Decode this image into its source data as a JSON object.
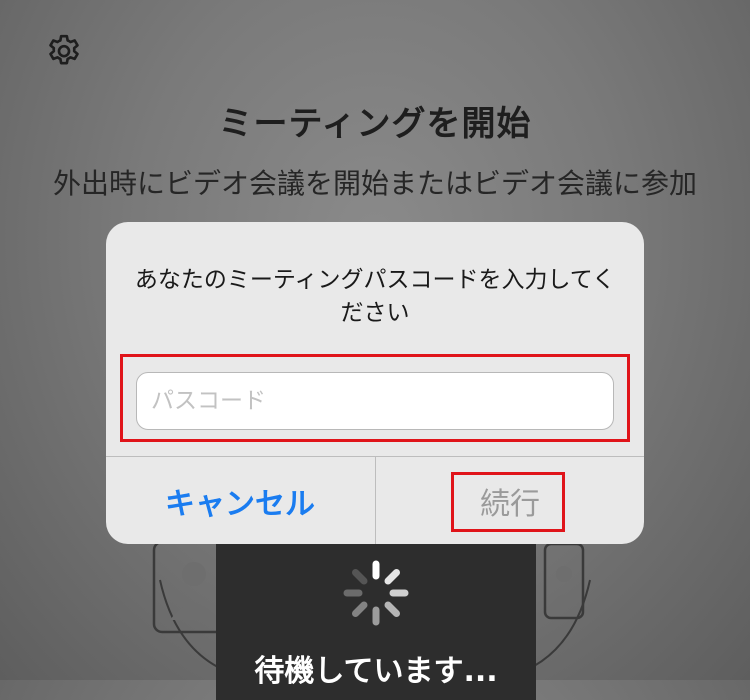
{
  "screen": {
    "title": "ミーティングを開始",
    "subtitle": "外出時にビデオ会議を開始またはビデオ会議に参加"
  },
  "settings": {
    "icon": "gear-icon"
  },
  "loading": {
    "text": "待機しています..."
  },
  "dialog": {
    "message": "あなたのミーティングパスコードを入力してください",
    "input": {
      "placeholder": "パスコード",
      "value": ""
    },
    "cancel_label": "キャンセル",
    "continue_label": "続行"
  },
  "colors": {
    "highlight": "#e0141a",
    "link_blue": "#1a7cf0",
    "disabled_gray": "#9a9a9a"
  }
}
